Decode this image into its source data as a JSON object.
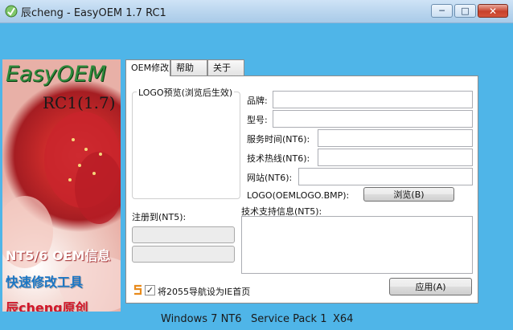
{
  "window": {
    "title": "辰cheng - EasyOEM 1.7 RC1"
  },
  "sidebar": {
    "title": "EasyOEM",
    "version": "RC1(1.7)",
    "line1": "NT5/6 OEM信息",
    "line2": "快速修改工具",
    "line3": "辰cheng原创"
  },
  "tabs": [
    {
      "label": "OEM修改",
      "active": true
    },
    {
      "label": "帮助",
      "active": false
    },
    {
      "label": "关于",
      "active": false
    }
  ],
  "oem": {
    "logo_group_label": "LOGO预览(浏览后生效)",
    "manufacturer_label": "品牌:",
    "manufacturer_value": "",
    "model_label": "型号:",
    "model_value": "",
    "hours_label": "服务时间(NT6):",
    "hours_value": "",
    "phone_label": "技术热线(NT6):",
    "phone_value": "",
    "url_label": "网站(NT6):",
    "url_value": "",
    "logo_label": "LOGO(OEMLOGO.BMP):",
    "browse_button": "浏览(B)",
    "registered_label": "注册到(NT5):",
    "registered_owner": "",
    "registered_org": "",
    "support_label": "技术支持信息(NT5):",
    "support_value": "",
    "homepage_checkbox": "将2055导航设为IE首页",
    "homepage_checked": true,
    "apply_button": "应用(A)"
  },
  "statusbar": {
    "os": "Windows 7 NT6",
    "sp": "Service Pack 1",
    "arch": "X64"
  },
  "colors": {
    "frame": "#4fb5e8",
    "panel": "#ffffff"
  }
}
